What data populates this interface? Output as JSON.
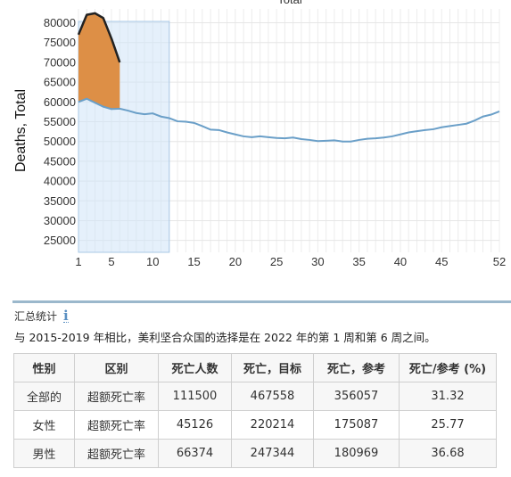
{
  "chart_data": {
    "type": "line",
    "title": "Total",
    "ylabel": "Deaths, Total",
    "xlabel": "",
    "x_ticks": [
      "1",
      "5",
      "10",
      "15",
      "20",
      "25",
      "30",
      "35",
      "40",
      "45",
      "52"
    ],
    "y_ticks": [
      "25000",
      "30000",
      "35000",
      "40000",
      "45000",
      "50000",
      "55000",
      "60000",
      "65000",
      "70000",
      "75000",
      "80000"
    ],
    "xlim": [
      1,
      52
    ],
    "ylim": [
      22000,
      83500
    ],
    "grid": true,
    "highlight_weeks": [
      1,
      12
    ],
    "series": [
      {
        "name": "",
        "role": "baseline",
        "color": "#6a9fc8",
        "x": [
          1,
          2,
          3,
          4,
          5,
          6,
          7,
          8,
          9,
          10,
          11,
          12,
          13,
          14,
          15,
          16,
          17,
          18,
          19,
          20,
          21,
          22,
          23,
          24,
          25,
          26,
          27,
          28,
          29,
          30,
          31,
          32,
          33,
          34,
          35,
          36,
          37,
          38,
          39,
          40,
          41,
          42,
          43,
          44,
          45,
          46,
          47,
          48,
          49,
          50,
          51,
          52
        ],
        "values": [
          60000,
          60800,
          59800,
          58800,
          58200,
          58300,
          57800,
          57200,
          56900,
          57100,
          56300,
          55900,
          55100,
          55000,
          54700,
          53900,
          53000,
          52900,
          52300,
          51800,
          51300,
          51100,
          51300,
          51100,
          50900,
          50800,
          51000,
          50600,
          50400,
          50100,
          50200,
          50300,
          50000,
          50000,
          50400,
          50700,
          50800,
          51000,
          51300,
          51800,
          52300,
          52600,
          52900,
          53100,
          53600,
          53900,
          54200,
          54500,
          55300,
          56300,
          56800,
          57600
        ]
      },
      {
        "name": "",
        "role": "observed",
        "color": "#222222",
        "x": [
          1,
          2,
          3,
          4,
          5,
          6
        ],
        "values": [
          77000,
          82000,
          82400,
          81200,
          76000,
          70000
        ]
      }
    ],
    "excess_fill_color": "#dd8f46",
    "highlight_color": "#cfe3f7"
  },
  "summary": {
    "heading": "汇总统计",
    "info_icon": "info-icon",
    "description": "与 2015-2019 年相比，美利坚合众国的选择是在 2022 年的第 1 周和第 6 周之间。"
  },
  "table": {
    "headers": [
      "性别",
      "区别",
      "死亡人数",
      "死亡，目标",
      "死亡，参考",
      "死亡/参考 (%)"
    ],
    "rows": [
      [
        "全部的",
        "超额死亡率",
        "111500",
        "467558",
        "356057",
        "31.32"
      ],
      [
        "女性",
        "超额死亡率",
        "45126",
        "220214",
        "175087",
        "25.77"
      ],
      [
        "男性",
        "超额死亡率",
        "66374",
        "247344",
        "180969",
        "36.68"
      ]
    ]
  }
}
